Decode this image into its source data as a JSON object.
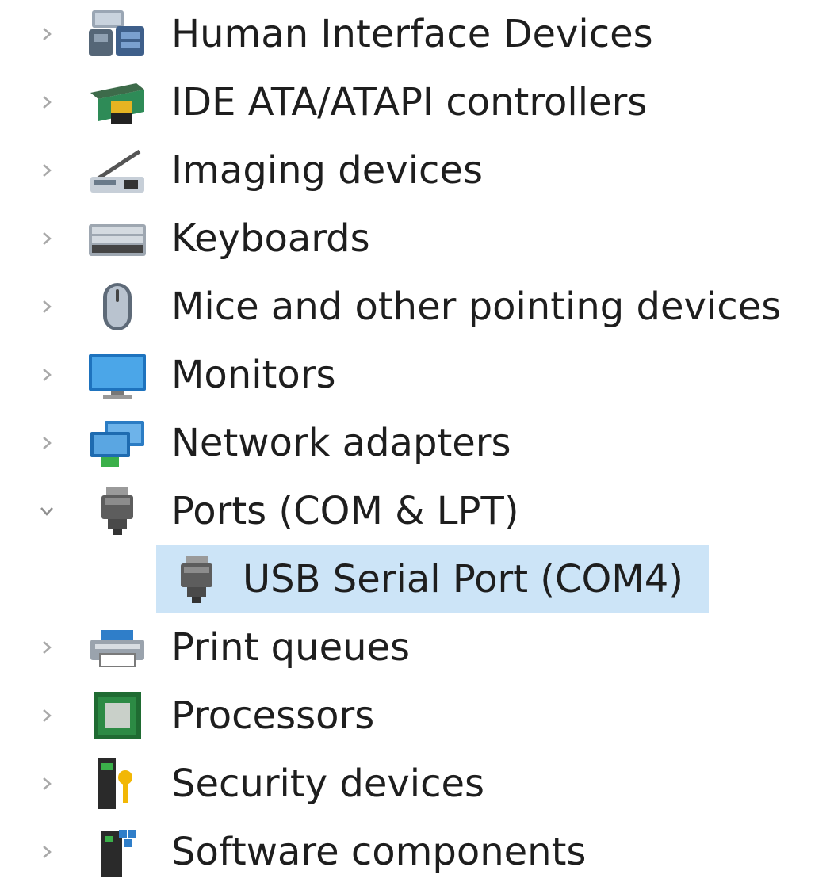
{
  "tree": {
    "items": [
      {
        "label": "Human Interface Devices",
        "expanded": false,
        "icon": "hid-icon"
      },
      {
        "label": "IDE ATA/ATAPI controllers",
        "expanded": false,
        "icon": "ide-controller-icon"
      },
      {
        "label": "Imaging devices",
        "expanded": false,
        "icon": "scanner-icon"
      },
      {
        "label": "Keyboards",
        "expanded": false,
        "icon": "keyboard-icon"
      },
      {
        "label": "Mice and other pointing devices",
        "expanded": false,
        "icon": "mouse-icon"
      },
      {
        "label": "Monitors",
        "expanded": false,
        "icon": "monitor-icon"
      },
      {
        "label": "Network adapters",
        "expanded": false,
        "icon": "network-adapter-icon"
      },
      {
        "label": "Ports (COM & LPT)",
        "expanded": true,
        "icon": "port-connector-icon",
        "children": [
          {
            "label": "USB Serial Port (COM4)",
            "selected": true,
            "icon": "port-connector-icon"
          }
        ]
      },
      {
        "label": "Print queues",
        "expanded": false,
        "icon": "printer-icon"
      },
      {
        "label": "Processors",
        "expanded": false,
        "icon": "processor-icon"
      },
      {
        "label": "Security devices",
        "expanded": false,
        "icon": "security-key-icon"
      },
      {
        "label": "Software components",
        "expanded": false,
        "icon": "software-component-icon"
      }
    ]
  },
  "colors": {
    "selection": "#cce4f7",
    "chevron": "#a9a9a9",
    "text": "#1e1e1e"
  }
}
